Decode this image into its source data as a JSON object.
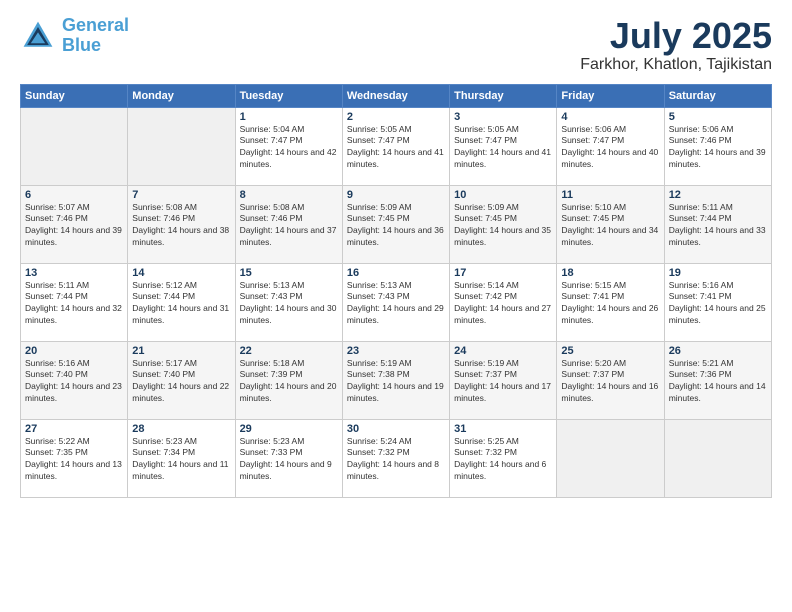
{
  "header": {
    "logo_line1": "General",
    "logo_line2": "Blue",
    "main_title": "July 2025",
    "subtitle": "Farkhor, Khatlon, Tajikistan"
  },
  "weekdays": [
    "Sunday",
    "Monday",
    "Tuesday",
    "Wednesday",
    "Thursday",
    "Friday",
    "Saturday"
  ],
  "weeks": [
    [
      {
        "day": "",
        "info": ""
      },
      {
        "day": "",
        "info": ""
      },
      {
        "day": "1",
        "info": "Sunrise: 5:04 AM\nSunset: 7:47 PM\nDaylight: 14 hours and 42 minutes."
      },
      {
        "day": "2",
        "info": "Sunrise: 5:05 AM\nSunset: 7:47 PM\nDaylight: 14 hours and 41 minutes."
      },
      {
        "day": "3",
        "info": "Sunrise: 5:05 AM\nSunset: 7:47 PM\nDaylight: 14 hours and 41 minutes."
      },
      {
        "day": "4",
        "info": "Sunrise: 5:06 AM\nSunset: 7:47 PM\nDaylight: 14 hours and 40 minutes."
      },
      {
        "day": "5",
        "info": "Sunrise: 5:06 AM\nSunset: 7:46 PM\nDaylight: 14 hours and 39 minutes."
      }
    ],
    [
      {
        "day": "6",
        "info": "Sunrise: 5:07 AM\nSunset: 7:46 PM\nDaylight: 14 hours and 39 minutes."
      },
      {
        "day": "7",
        "info": "Sunrise: 5:08 AM\nSunset: 7:46 PM\nDaylight: 14 hours and 38 minutes."
      },
      {
        "day": "8",
        "info": "Sunrise: 5:08 AM\nSunset: 7:46 PM\nDaylight: 14 hours and 37 minutes."
      },
      {
        "day": "9",
        "info": "Sunrise: 5:09 AM\nSunset: 7:45 PM\nDaylight: 14 hours and 36 minutes."
      },
      {
        "day": "10",
        "info": "Sunrise: 5:09 AM\nSunset: 7:45 PM\nDaylight: 14 hours and 35 minutes."
      },
      {
        "day": "11",
        "info": "Sunrise: 5:10 AM\nSunset: 7:45 PM\nDaylight: 14 hours and 34 minutes."
      },
      {
        "day": "12",
        "info": "Sunrise: 5:11 AM\nSunset: 7:44 PM\nDaylight: 14 hours and 33 minutes."
      }
    ],
    [
      {
        "day": "13",
        "info": "Sunrise: 5:11 AM\nSunset: 7:44 PM\nDaylight: 14 hours and 32 minutes."
      },
      {
        "day": "14",
        "info": "Sunrise: 5:12 AM\nSunset: 7:44 PM\nDaylight: 14 hours and 31 minutes."
      },
      {
        "day": "15",
        "info": "Sunrise: 5:13 AM\nSunset: 7:43 PM\nDaylight: 14 hours and 30 minutes."
      },
      {
        "day": "16",
        "info": "Sunrise: 5:13 AM\nSunset: 7:43 PM\nDaylight: 14 hours and 29 minutes."
      },
      {
        "day": "17",
        "info": "Sunrise: 5:14 AM\nSunset: 7:42 PM\nDaylight: 14 hours and 27 minutes."
      },
      {
        "day": "18",
        "info": "Sunrise: 5:15 AM\nSunset: 7:41 PM\nDaylight: 14 hours and 26 minutes."
      },
      {
        "day": "19",
        "info": "Sunrise: 5:16 AM\nSunset: 7:41 PM\nDaylight: 14 hours and 25 minutes."
      }
    ],
    [
      {
        "day": "20",
        "info": "Sunrise: 5:16 AM\nSunset: 7:40 PM\nDaylight: 14 hours and 23 minutes."
      },
      {
        "day": "21",
        "info": "Sunrise: 5:17 AM\nSunset: 7:40 PM\nDaylight: 14 hours and 22 minutes."
      },
      {
        "day": "22",
        "info": "Sunrise: 5:18 AM\nSunset: 7:39 PM\nDaylight: 14 hours and 20 minutes."
      },
      {
        "day": "23",
        "info": "Sunrise: 5:19 AM\nSunset: 7:38 PM\nDaylight: 14 hours and 19 minutes."
      },
      {
        "day": "24",
        "info": "Sunrise: 5:19 AM\nSunset: 7:37 PM\nDaylight: 14 hours and 17 minutes."
      },
      {
        "day": "25",
        "info": "Sunrise: 5:20 AM\nSunset: 7:37 PM\nDaylight: 14 hours and 16 minutes."
      },
      {
        "day": "26",
        "info": "Sunrise: 5:21 AM\nSunset: 7:36 PM\nDaylight: 14 hours and 14 minutes."
      }
    ],
    [
      {
        "day": "27",
        "info": "Sunrise: 5:22 AM\nSunset: 7:35 PM\nDaylight: 14 hours and 13 minutes."
      },
      {
        "day": "28",
        "info": "Sunrise: 5:23 AM\nSunset: 7:34 PM\nDaylight: 14 hours and 11 minutes."
      },
      {
        "day": "29",
        "info": "Sunrise: 5:23 AM\nSunset: 7:33 PM\nDaylight: 14 hours and 9 minutes."
      },
      {
        "day": "30",
        "info": "Sunrise: 5:24 AM\nSunset: 7:32 PM\nDaylight: 14 hours and 8 minutes."
      },
      {
        "day": "31",
        "info": "Sunrise: 5:25 AM\nSunset: 7:32 PM\nDaylight: 14 hours and 6 minutes."
      },
      {
        "day": "",
        "info": ""
      },
      {
        "day": "",
        "info": ""
      }
    ]
  ]
}
